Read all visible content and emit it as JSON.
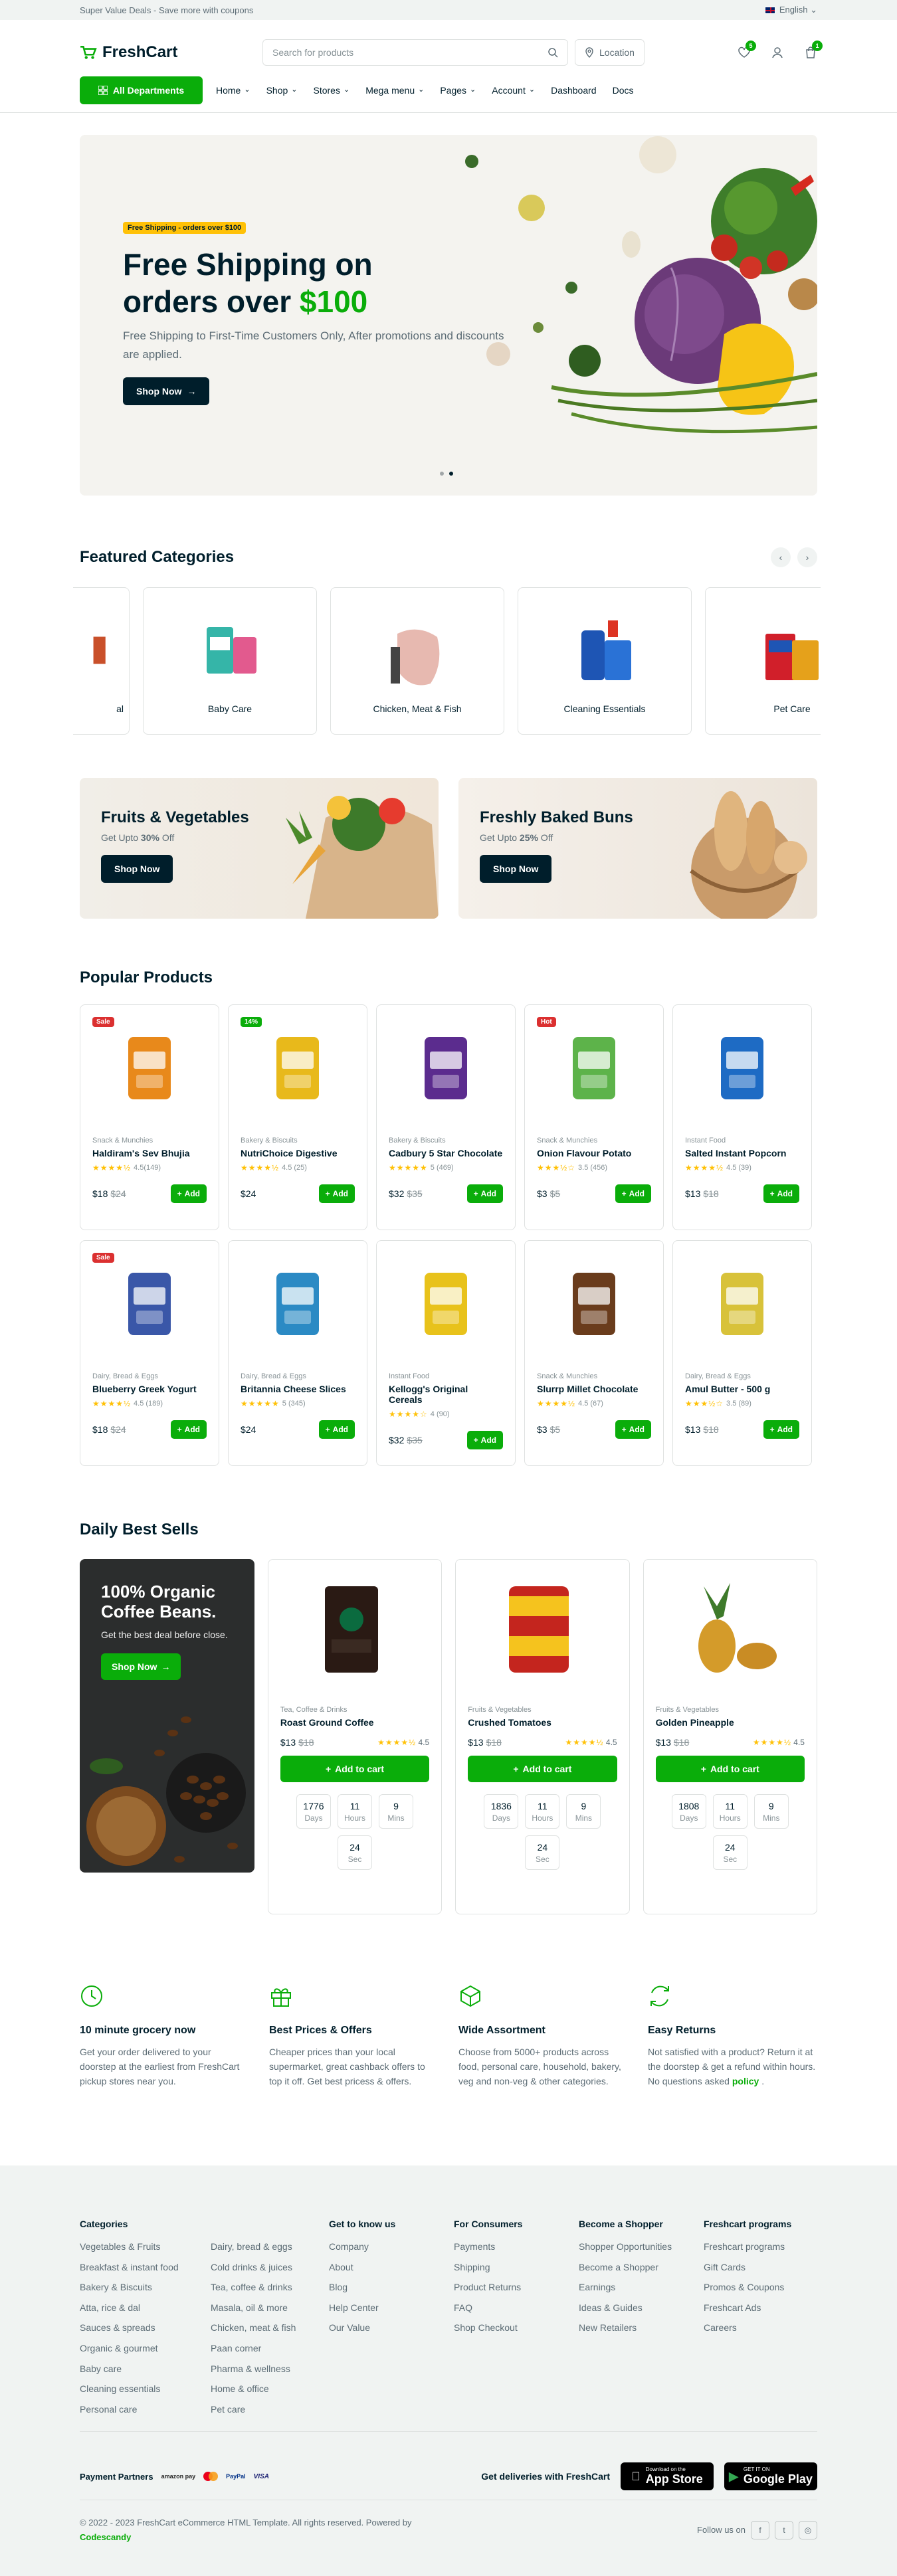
{
  "topbar": {
    "promo": "Super Value Deals - Save more with coupons",
    "language": "English"
  },
  "header": {
    "logo": "FreshCart",
    "search_placeholder": "Search for products",
    "location": "Location",
    "wishlist_count": "5",
    "cart_count": "1"
  },
  "nav": {
    "departments": "All Departments",
    "items": [
      {
        "label": "Home",
        "dropdown": true
      },
      {
        "label": "Shop",
        "dropdown": true
      },
      {
        "label": "Stores",
        "dropdown": true
      },
      {
        "label": "Mega menu",
        "dropdown": true
      },
      {
        "label": "Pages",
        "dropdown": true
      },
      {
        "label": "Account",
        "dropdown": true
      },
      {
        "label": "Dashboard",
        "dropdown": false
      },
      {
        "label": "Docs",
        "dropdown": false
      }
    ]
  },
  "hero": {
    "chip": "Free Shipping - orders over $100",
    "title_line1": "Free Shipping on",
    "title_line2_a": "orders over ",
    "title_line2_b": "$100",
    "desc": "Free Shipping to First-Time Customers Only, After promotions and discounts are applied.",
    "button": "Shop Now"
  },
  "featured": {
    "title": "Featured Categories",
    "items": [
      {
        "label": "al"
      },
      {
        "label": "Baby Care"
      },
      {
        "label": "Chicken, Meat & Fish"
      },
      {
        "label": "Cleaning Essentials"
      },
      {
        "label": "Pet Care"
      }
    ]
  },
  "promos": [
    {
      "title": "Fruits & Vegetables",
      "sub_a": "Get Upto ",
      "sub_b": "30%",
      "sub_c": " Off",
      "button": "Shop Now"
    },
    {
      "title": "Freshly Baked Buns",
      "sub_a": "Get Upto ",
      "sub_b": "25%",
      "sub_c": " Off",
      "button": "Shop Now"
    }
  ],
  "popular": {
    "title": "Popular Products",
    "add_label": "Add",
    "products": [
      {
        "tag": "Sale",
        "tag_color": "red",
        "category": "Snack & Munchies",
        "name": "Haldiram's Sev Bhujia",
        "stars": "★★★★½",
        "rating": "4.5(149)",
        "price": "$18",
        "old": "$24",
        "color": "#e8891b"
      },
      {
        "tag": "14%",
        "tag_color": "green",
        "category": "Bakery & Biscuits",
        "name": "NutriChoice Digestive",
        "stars": "★★★★½",
        "rating": "4.5 (25)",
        "price": "$24",
        "old": "",
        "color": "#e8b91b"
      },
      {
        "tag": "",
        "tag_color": "",
        "category": "Bakery & Biscuits",
        "name": "Cadbury 5 Star Chocolate",
        "stars": "★★★★★",
        "rating": "5 (469)",
        "price": "$32",
        "old": "$35",
        "color": "#5b2c8e"
      },
      {
        "tag": "Hot",
        "tag_color": "red",
        "category": "Snack & Munchies",
        "name": "Onion Flavour Potato",
        "stars": "★★★½☆",
        "rating": "3.5 (456)",
        "price": "$3",
        "old": "$5",
        "color": "#5db34a"
      },
      {
        "tag": "",
        "tag_color": "",
        "category": "Instant Food",
        "name": "Salted Instant Popcorn",
        "stars": "★★★★½",
        "rating": "4.5 (39)",
        "price": "$13",
        "old": "$18",
        "color": "#1e6bc4"
      },
      {
        "tag": "Sale",
        "tag_color": "red",
        "category": "Dairy, Bread & Eggs",
        "name": "Blueberry Greek Yogurt",
        "stars": "★★★★½",
        "rating": "4.5 (189)",
        "price": "$18",
        "old": "$24",
        "color": "#3a57a8"
      },
      {
        "tag": "",
        "tag_color": "",
        "category": "Dairy, Bread & Eggs",
        "name": "Britannia Cheese Slices",
        "stars": "★★★★★",
        "rating": "5 (345)",
        "price": "$24",
        "old": "",
        "color": "#2b8ac4"
      },
      {
        "tag": "",
        "tag_color": "",
        "category": "Instant Food",
        "name": "Kellogg's Original Cereals",
        "stars": "★★★★☆",
        "rating": "4 (90)",
        "price": "$32",
        "old": "$35",
        "color": "#e8c21b"
      },
      {
        "tag": "",
        "tag_color": "",
        "category": "Snack & Munchies",
        "name": "Slurrp Millet Chocolate",
        "stars": "★★★★½",
        "rating": "4.5 (67)",
        "price": "$3",
        "old": "$5",
        "color": "#6a3c1c"
      },
      {
        "tag": "",
        "tag_color": "",
        "category": "Dairy, Bread & Eggs",
        "name": "Amul Butter - 500 g",
        "stars": "★★★½☆",
        "rating": "3.5 (89)",
        "price": "$13",
        "old": "$18",
        "color": "#d8c23a"
      }
    ]
  },
  "daily": {
    "title": "Daily Best Sells",
    "banner_title": "100% Organic Coffee Beans.",
    "banner_desc": "Get the best deal before close.",
    "banner_button": "Shop Now",
    "add_label": "Add to cart",
    "products": [
      {
        "category": "Tea, Coffee & Drinks",
        "name": "Roast Ground Coffee",
        "price": "$13",
        "old": "$18",
        "rating": "4.5",
        "timer": [
          {
            "v": "1776",
            "l": "Days"
          },
          {
            "v": "11",
            "l": "Hours"
          },
          {
            "v": "9",
            "l": "Mins"
          },
          {
            "v": "24",
            "l": "Sec"
          }
        ]
      },
      {
        "category": "Fruits & Vegetables",
        "name": "Crushed Tomatoes",
        "price": "$13",
        "old": "$18",
        "rating": "4.5",
        "timer": [
          {
            "v": "1836",
            "l": "Days"
          },
          {
            "v": "11",
            "l": "Hours"
          },
          {
            "v": "9",
            "l": "Mins"
          },
          {
            "v": "24",
            "l": "Sec"
          }
        ]
      },
      {
        "category": "Fruits & Vegetables",
        "name": "Golden Pineapple",
        "price": "$13",
        "old": "$18",
        "rating": "4.5",
        "timer": [
          {
            "v": "1808",
            "l": "Days"
          },
          {
            "v": "11",
            "l": "Hours"
          },
          {
            "v": "9",
            "l": "Mins"
          },
          {
            "v": "24",
            "l": "Sec"
          }
        ]
      }
    ]
  },
  "features": [
    {
      "icon": "clock-icon",
      "title": "10 minute grocery now",
      "desc": "Get your order delivered to your doorstep at the earliest from FreshCart pickup stores near you.",
      "link": ""
    },
    {
      "icon": "gift-icon",
      "title": "Best Prices & Offers",
      "desc": "Cheaper prices than your local supermarket, great cashback offers to top it off. Get best pricess & offers.",
      "link": ""
    },
    {
      "icon": "package-icon",
      "title": "Wide Assortment",
      "desc": "Choose from 5000+ products across food, personal care, household, bakery, veg and non-veg & other categories.",
      "link": ""
    },
    {
      "icon": "refresh-icon",
      "title": "Easy Returns",
      "desc": "Not satisfied with a product? Return it at the doorstep & get a refund within hours. No questions asked ",
      "link": "policy"
    }
  ],
  "footer": {
    "columns": [
      {
        "title": "Categories",
        "items": [
          "Vegetables & Fruits",
          "Breakfast & instant food",
          "Bakery & Biscuits",
          "Atta, rice & dal",
          "Sauces & spreads",
          "Organic & gourmet",
          "Baby care",
          "Cleaning essentials",
          "Personal care"
        ]
      },
      {
        "title": "",
        "items": [
          "Dairy, bread & eggs",
          "Cold drinks & juices",
          "Tea, coffee & drinks",
          "Masala, oil & more",
          "Chicken, meat & fish",
          "Paan corner",
          "Pharma & wellness",
          "Home & office",
          "Pet care"
        ]
      },
      {
        "title": "Get to know us",
        "items": [
          "Company",
          "About",
          "Blog",
          "Help Center",
          "Our Value"
        ]
      },
      {
        "title": "For Consumers",
        "items": [
          "Payments",
          "Shipping",
          "Product Returns",
          "FAQ",
          "Shop Checkout"
        ]
      },
      {
        "title": "Become a Shopper",
        "items": [
          "Shopper Opportunities",
          "Become a Shopper",
          "Earnings",
          "Ideas & Guides",
          "New Retailers"
        ]
      },
      {
        "title": "Freshcart programs",
        "items": [
          "Freshcart programs",
          "Gift Cards",
          "Promos & Coupons",
          "Freshcart Ads",
          "Careers"
        ]
      }
    ],
    "payment_label": "Payment Partners",
    "payments": [
      "amazon pay",
      "mastercard",
      "PayPal",
      "VISA"
    ],
    "deliveries": "Get deliveries with FreshCart",
    "appstore_small": "Download on the",
    "appstore": "App Store",
    "play_small": "GET IT ON",
    "play": "Google Play",
    "copyright": "© 2022 - 2023 FreshCart eCommerce HTML Template. All rights reserved. Powered by",
    "powered": "Codescandy",
    "follow": "Follow us on"
  }
}
